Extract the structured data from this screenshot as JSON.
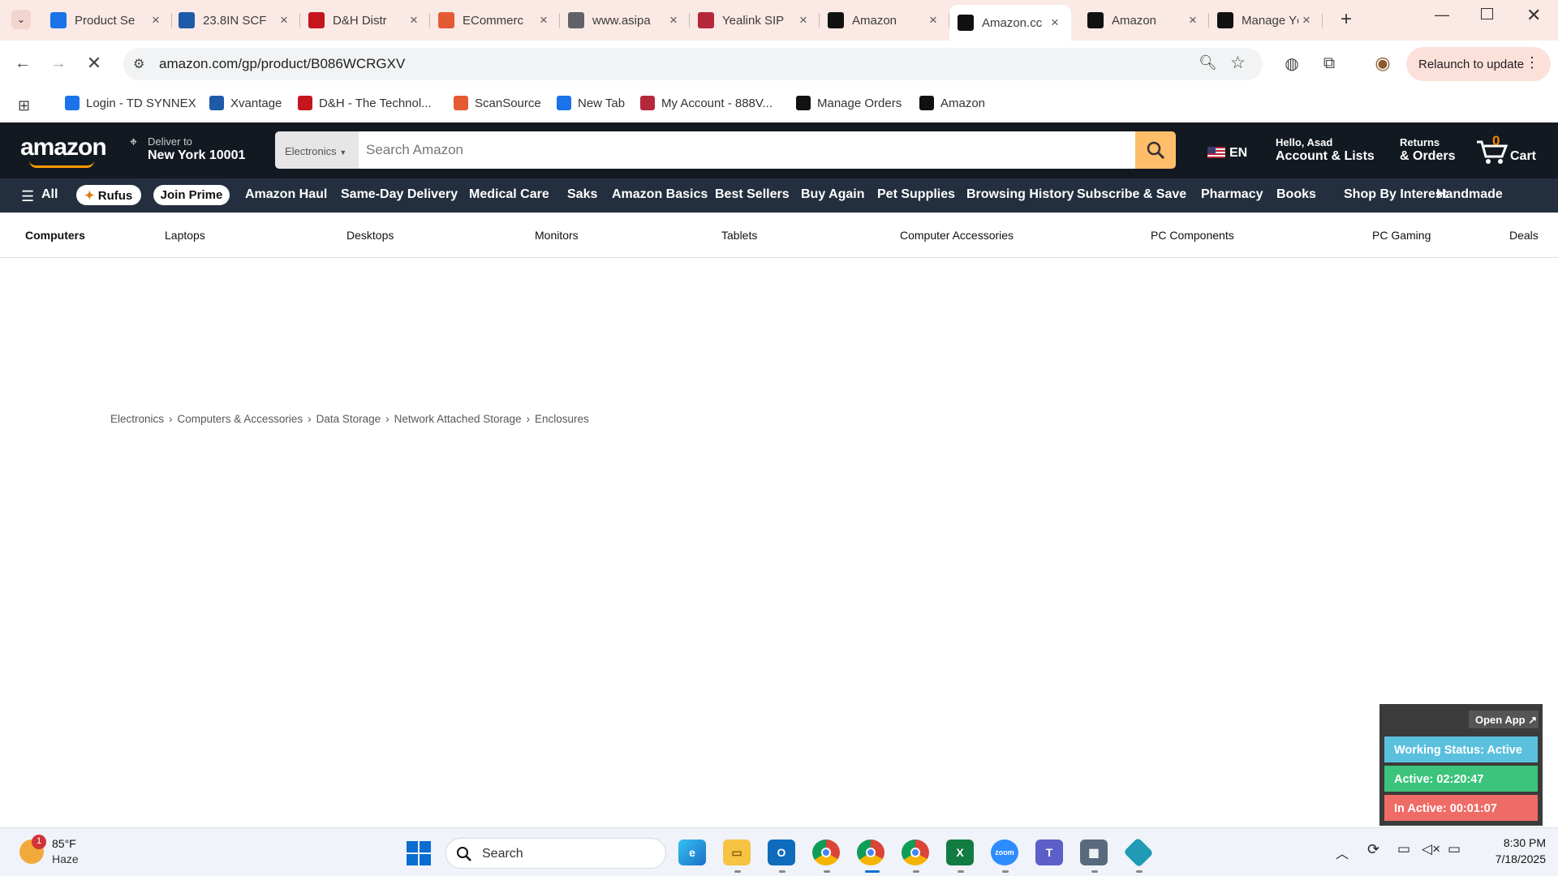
{
  "browser": {
    "tabs": [
      {
        "title": "Product Se",
        "icon": "ec-favicon",
        "color": "#1a73e8"
      },
      {
        "title": "23.8IN SCF",
        "icon": "ingram-favicon",
        "color": "#1e5aa8"
      },
      {
        "title": "D&H Distr",
        "icon": "dh-favicon",
        "color": "#c4161c"
      },
      {
        "title": "ECommerc",
        "icon": "scansource-favicon",
        "color": "#e45a33"
      },
      {
        "title": "www.asipa",
        "icon": "globe-favicon",
        "color": "#5f6368"
      },
      {
        "title": "Yealink SIP",
        "icon": "yealink-favicon",
        "color": "#b5283b"
      },
      {
        "title": "Amazon",
        "icon": "amazon-favicon",
        "color": "#111111"
      },
      {
        "title": "Amazon.cc",
        "icon": "amazon-favicon",
        "color": "#111111",
        "active": true
      },
      {
        "title": "Amazon",
        "icon": "amazon-favicon",
        "color": "#111111"
      },
      {
        "title": "Manage Yc",
        "icon": "amazon-favicon",
        "color": "#111111"
      }
    ],
    "new_tab_label": "+",
    "url": "amazon.com/gp/product/B086WCRGXV",
    "relaunch_label": "Relaunch to update",
    "bookmarks": [
      {
        "label": "Login - TD SYNNEX",
        "color": "#1a73e8"
      },
      {
        "label": "Xvantage",
        "color": "#1e5aa8"
      },
      {
        "label": "D&H - The Technol...",
        "color": "#c4161c"
      },
      {
        "label": "ScanSource",
        "color": "#e45a33"
      },
      {
        "label": "New Tab",
        "color": "#1a73e8"
      },
      {
        "label": "My Account - 888V...",
        "color": "#b5283b"
      },
      {
        "label": "Manage Orders",
        "color": "#111111"
      },
      {
        "label": "Amazon",
        "color": "#111111"
      }
    ]
  },
  "amazon": {
    "logo": "amazon",
    "deliver_line1": "Deliver to",
    "deliver_line2": "New York 10001",
    "search_category": "Electronics",
    "search_placeholder": "Search Amazon",
    "language": "EN",
    "account_line1": "Hello, Asad",
    "account_line2": "Account & Lists",
    "returns_line1": "Returns",
    "returns_line2": "& Orders",
    "cart_count": "0",
    "cart_label": "Cart",
    "nav_all": "All",
    "nav_items": [
      "Rufus",
      "Join Prime",
      "Amazon Haul",
      "Same-Day Delivery",
      "Medical Care",
      "Saks",
      "Amazon Basics",
      "Best Sellers",
      "Buy Again",
      "Pet Supplies",
      "Browsing History",
      "Subscribe & Save",
      "Pharmacy",
      "Books",
      "Shop By Interest",
      "Handmade"
    ],
    "sub_nav": [
      "Computers",
      "Laptops",
      "Desktops",
      "Monitors",
      "Tablets",
      "Computer Accessories",
      "PC Components",
      "PC Gaming",
      "Deals"
    ],
    "breadcrumb": [
      "Electronics",
      "Computers & Accessories",
      "Data Storage",
      "Network Attached Storage",
      "Enclosures"
    ]
  },
  "tracker": {
    "open_app": "Open App ↗",
    "working_status": "Working Status: Active",
    "active": "Active: 02:20:47",
    "inactive": "In Active: 00:01:07",
    "colors": {
      "status": "#5bc0de",
      "active": "#3cc47c",
      "inactive": "#ef6b66"
    }
  },
  "taskbar": {
    "weather_temp": "85°F",
    "weather_desc": "Haze",
    "weather_badge": "1",
    "search_placeholder": "Search",
    "time": "8:30 PM",
    "date": "7/18/2025"
  }
}
